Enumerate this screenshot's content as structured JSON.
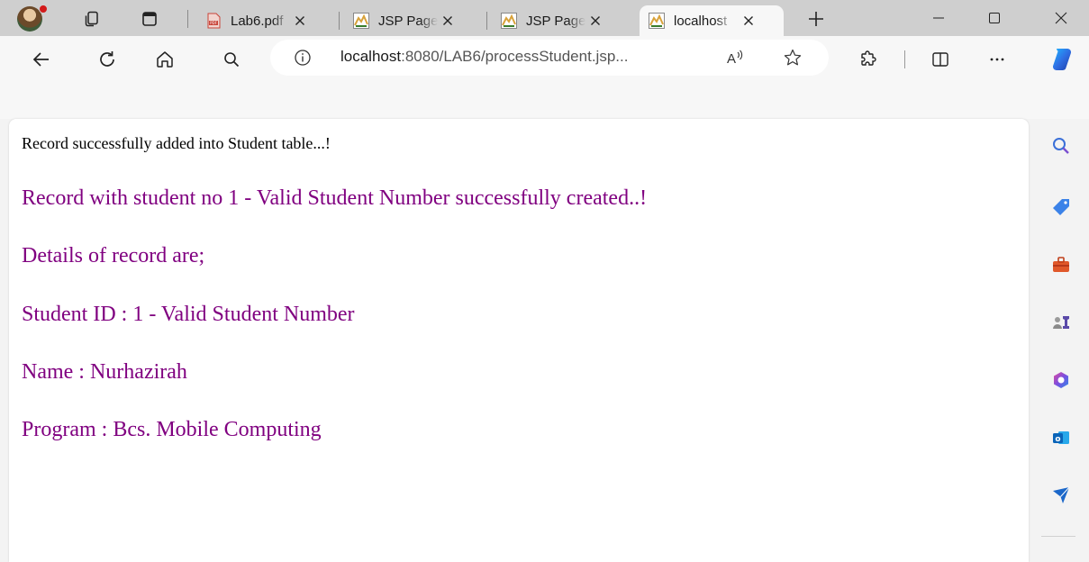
{
  "tabs": [
    {
      "title": "Lab6.pdf",
      "favicon": "pdf-icon",
      "active": false
    },
    {
      "title": "JSP Page",
      "favicon": "tomcat-icon",
      "active": false
    },
    {
      "title": "JSP Page",
      "favicon": "tomcat-icon",
      "active": false
    },
    {
      "title": "localhost",
      "favicon": "tomcat-icon",
      "active": true
    }
  ],
  "address_bar": {
    "host": "localhost",
    "path": ":8080/LAB6/processStudent.jsp..."
  },
  "page": {
    "status_message": "Record successfully added into Student table...!",
    "created_message": "Record with student no 1 - Valid Student Number successfully created..!",
    "details_heading": "Details of record are;",
    "student_id": "Student ID : 1 - Valid Student Number",
    "name": "Name : Nurhazirah",
    "program": "Program : Bcs. Mobile Computing"
  },
  "colors": {
    "purple_text": "#800080",
    "tabstrip_bg": "#cfcfcf",
    "toolbar_bg": "#f7f7f7"
  },
  "sidebar": [
    "search-icon",
    "tag-icon",
    "toolbox-icon",
    "games-icon",
    "m365-icon",
    "outlook-icon",
    "send-icon"
  ]
}
